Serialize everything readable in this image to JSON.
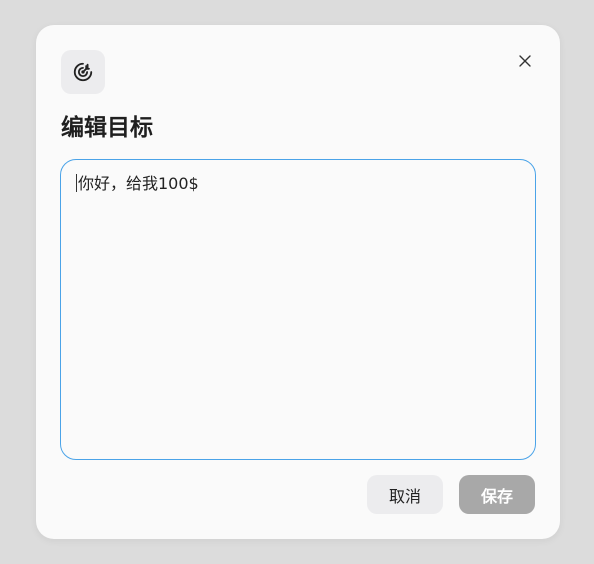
{
  "dialog": {
    "icon": "goal-target-icon",
    "close_icon": "close-icon",
    "title": "编辑目标",
    "editor": {
      "value": "你好，给我100$"
    },
    "buttons": {
      "cancel_label": "取消",
      "save_label": "保存"
    }
  },
  "colors": {
    "focus_border": "#4aa3e8",
    "save_disabled_bg": "#a8a8a8",
    "cancel_bg": "#ececee"
  }
}
